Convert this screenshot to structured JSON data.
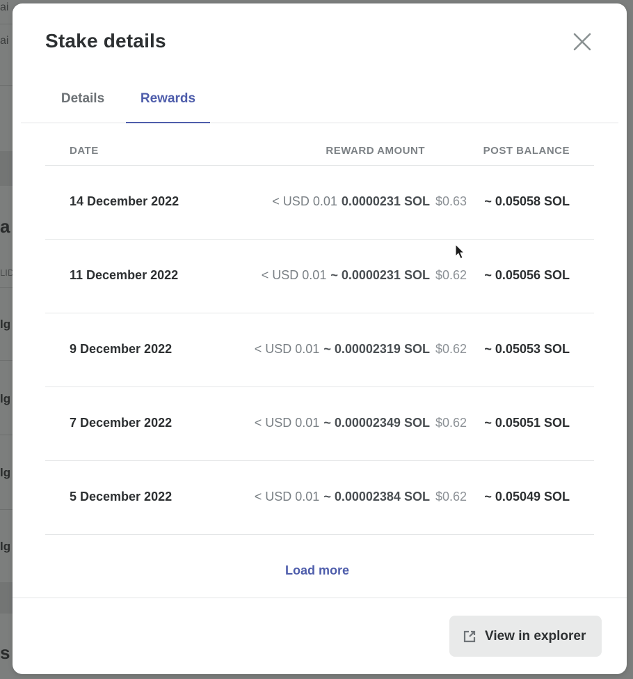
{
  "background_page": {
    "fragments": [
      "ai",
      "ai",
      "a",
      "LID",
      "lg",
      "lg",
      "lg",
      "lg",
      "s"
    ]
  },
  "modal": {
    "title": "Stake details",
    "close_icon": "close-icon",
    "tabs": [
      {
        "label": "Details",
        "active": false
      },
      {
        "label": "Rewards",
        "active": true
      }
    ],
    "table": {
      "headers": {
        "date": "DATE",
        "reward_amount": "REWARD AMOUNT",
        "post_balance": "POST BALANCE"
      },
      "rows": [
        {
          "date": "14 December 2022",
          "usd_reward": "< USD 0.01",
          "sol_reward": "0.0000231 SOL",
          "usd_balance": "$0.63",
          "post_balance": "~ 0.05058 SOL"
        },
        {
          "date": "11 December 2022",
          "usd_reward": "< USD 0.01",
          "sol_reward": "~ 0.0000231 SOL",
          "usd_balance": "$0.62",
          "post_balance": "~ 0.05056 SOL"
        },
        {
          "date": "9 December 2022",
          "usd_reward": "< USD 0.01",
          "sol_reward": "~ 0.00002319 SOL",
          "usd_balance": "$0.62",
          "post_balance": "~ 0.05053 SOL"
        },
        {
          "date": "7 December 2022",
          "usd_reward": "< USD 0.01",
          "sol_reward": "~ 0.00002349 SOL",
          "usd_balance": "$0.62",
          "post_balance": "~ 0.05051 SOL"
        },
        {
          "date": "5 December 2022",
          "usd_reward": "< USD 0.01",
          "sol_reward": "~ 0.00002384 SOL",
          "usd_balance": "$0.62",
          "post_balance": "~ 0.05049 SOL"
        }
      ]
    },
    "load_more_label": "Load more",
    "view_in_explorer_label": "View in explorer",
    "colors": {
      "accent": "#4e5dab",
      "overlay": "#7c7e7d",
      "button_bg": "#e9eaea"
    }
  }
}
